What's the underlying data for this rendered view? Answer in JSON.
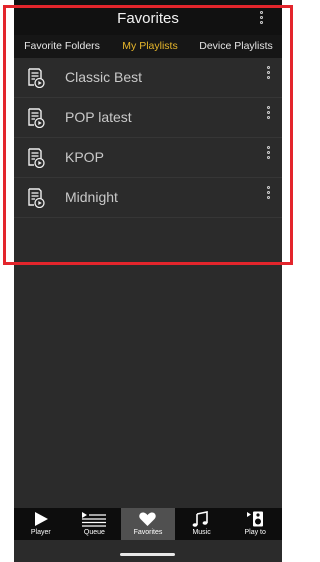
{
  "header": {
    "title": "Favorites",
    "menu_icon": "more-vertical-icon"
  },
  "tabs": [
    {
      "label": "Favorite Folders",
      "active": false
    },
    {
      "label": "My Playlists",
      "active": true
    },
    {
      "label": "Device Playlists",
      "active": false
    }
  ],
  "playlists": [
    {
      "name": "Classic Best",
      "icon": "playlist-icon"
    },
    {
      "name": "POP latest",
      "icon": "playlist-icon"
    },
    {
      "name": "KPOP",
      "icon": "playlist-icon"
    },
    {
      "name": "Midnight",
      "icon": "playlist-icon"
    }
  ],
  "tabbar": [
    {
      "label": "Player",
      "icon": "play-icon",
      "active": false
    },
    {
      "label": "Queue",
      "icon": "queue-icon",
      "active": false
    },
    {
      "label": "Favorites",
      "icon": "heart-icon",
      "active": true
    },
    {
      "label": "Music",
      "icon": "music-note-icon",
      "active": false
    },
    {
      "label": "Play to",
      "icon": "speaker-icon",
      "active": false
    }
  ],
  "colors": {
    "accent": "#e7b62b",
    "highlight_border": "#e3252c",
    "background": "#2b2b2b"
  }
}
